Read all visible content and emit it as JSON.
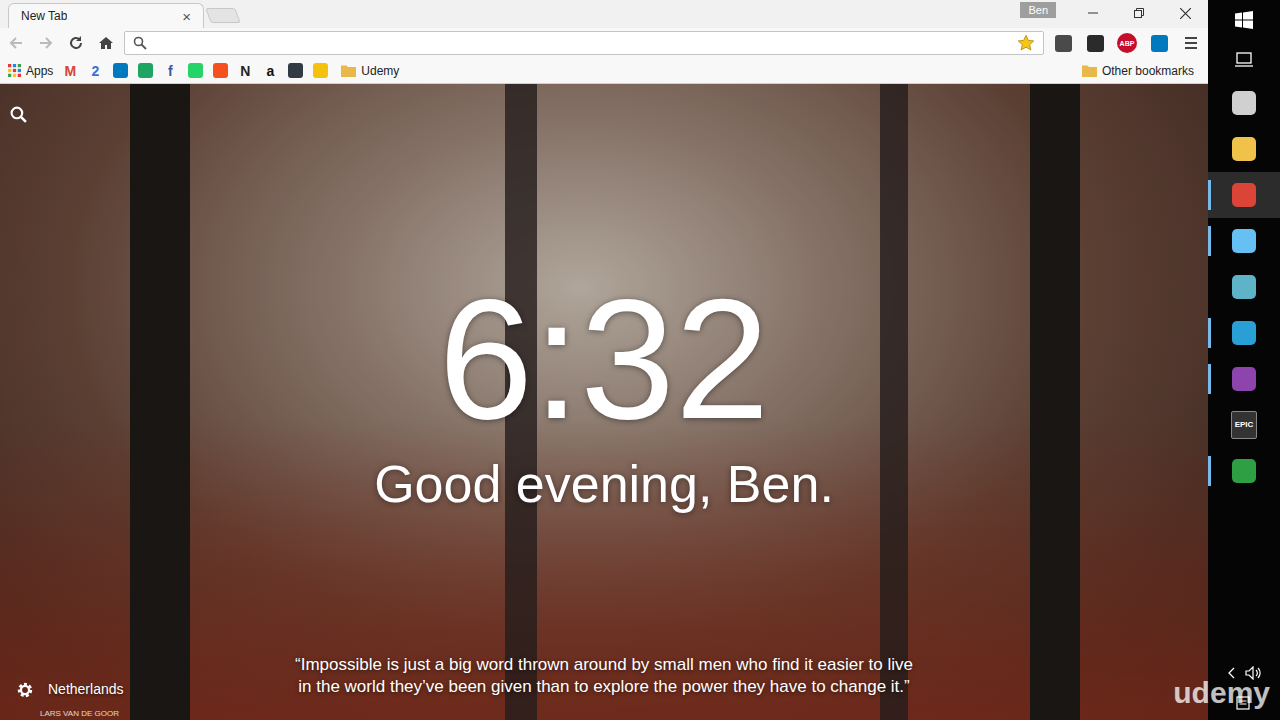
{
  "window": {
    "title": "New Tab",
    "profile": "Ben"
  },
  "tabs": [
    {
      "label": "New Tab",
      "selected": true,
      "close": "×"
    }
  ],
  "toolbar": {
    "bookmarked": true,
    "extensions": [
      {
        "kind": "icon",
        "color": "#4a4a4a"
      },
      {
        "kind": "icon",
        "color": "#2b2b2b"
      },
      {
        "kind": "letter",
        "text": "ABP",
        "color": "#c70d2c"
      },
      {
        "kind": "icon",
        "color": "#0079bf"
      }
    ]
  },
  "bookmarks": {
    "apps": "Apps",
    "items": [
      {
        "kind": "letter",
        "text": "M",
        "color": "#d44638"
      },
      {
        "kind": "letter",
        "text": "2",
        "color": "#3b6fd1"
      },
      {
        "kind": "icon",
        "color": "#0079bf"
      },
      {
        "kind": "icon",
        "color": "#1fa463"
      },
      {
        "kind": "letter",
        "text": "f",
        "color": "#3b5998"
      },
      {
        "kind": "icon",
        "color": "#25d366"
      },
      {
        "kind": "icon",
        "color": "#f4511e"
      },
      {
        "kind": "letter",
        "text": "N",
        "color": "#222222"
      },
      {
        "kind": "letter",
        "text": "a",
        "color": "#111111"
      },
      {
        "kind": "icon",
        "color": "#323b43"
      },
      {
        "kind": "icon",
        "color": "#f4c20d"
      }
    ],
    "folder": "Udemy",
    "other": "Other bookmarks"
  },
  "newtab": {
    "time": "6:32",
    "greeting": "Good evening, Ben.",
    "quote": "“Impossible is just a big word thrown around by small men who find it easier to live in the world they’ve been given than to explore the power they have to change it.”",
    "location": "Netherlands",
    "credit": "LARS VAN DE GOOR"
  },
  "watermark": "udemy",
  "taskbar": {
    "apps": [
      {
        "kind": "icon",
        "color": "#d0d0d0",
        "running": false,
        "selected": false
      },
      {
        "kind": "icon",
        "color": "#f0c24a",
        "running": false,
        "selected": false
      },
      {
        "kind": "icon",
        "color": "#db4437",
        "running": true,
        "selected": true
      },
      {
        "kind": "icon",
        "color": "#66c0f4",
        "running": true,
        "selected": false
      },
      {
        "kind": "icon",
        "color": "#5fb3c9",
        "running": false,
        "selected": false
      },
      {
        "kind": "icon",
        "color": "#2a9fd6",
        "running": true,
        "selected": false
      },
      {
        "kind": "icon",
        "color": "#8e44ad",
        "running": true,
        "selected": false
      },
      {
        "kind": "letter",
        "text": "EPIC",
        "color": "#333333",
        "running": false,
        "selected": false
      },
      {
        "kind": "icon",
        "color": "#2ea043",
        "running": true,
        "selected": false
      }
    ]
  }
}
